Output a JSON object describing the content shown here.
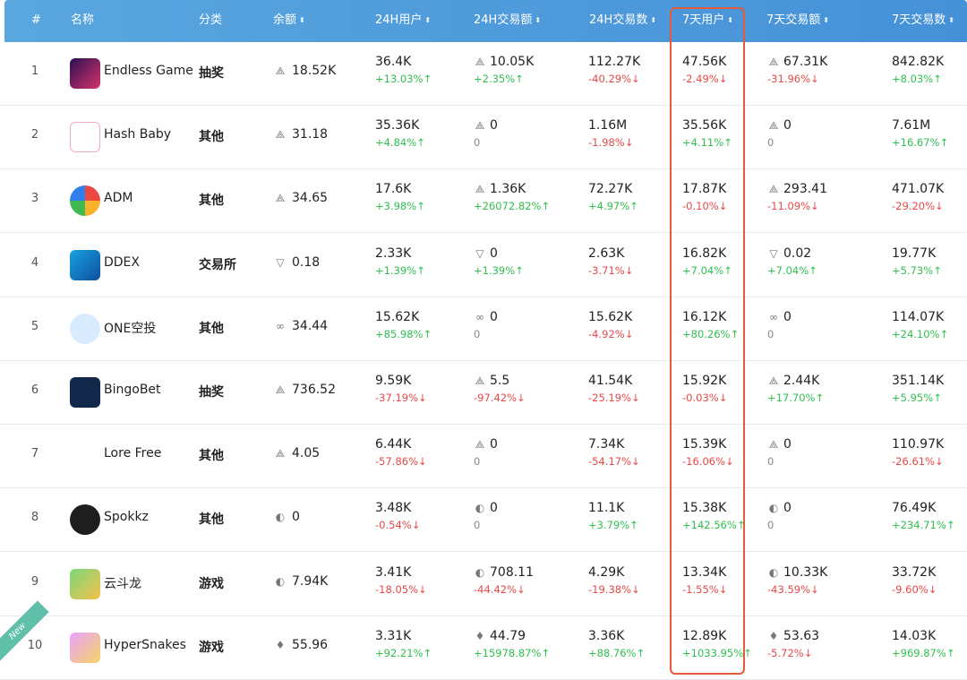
{
  "header": {
    "rank": "#",
    "name": "名称",
    "category": "分类",
    "balance": "余额",
    "users_24h": "24H用户",
    "volume_24h": "24H交易额",
    "tx_24h": "24H交易数",
    "users_7d": "7天用户",
    "volume_7d": "7天交易额",
    "tx_7d": "7天交易数",
    "sort_icon": "⬍"
  },
  "badge_new": "New",
  "accent_color": "#e55a3b",
  "rows": [
    {
      "rank": "1",
      "name": "Endless Game",
      "category": "抽奖",
      "token_icon": "eos-icon",
      "balance": "18.52K",
      "users_24h": "36.4K",
      "users_24h_change": "+13.03%",
      "vol_24h": "10.05K",
      "vol_24h_change": "+2.35%",
      "tx_24h": "112.27K",
      "tx_24h_change": "-40.29%",
      "users_7d": "47.56K",
      "users_7d_change": "-2.49%",
      "vol_7d": "67.31K",
      "vol_7d_change": "-31.96%",
      "tx_7d": "842.82K",
      "tx_7d_change": "+8.03%"
    },
    {
      "rank": "2",
      "name": "Hash Baby",
      "category": "其他",
      "token_icon": "eos-icon",
      "balance": "31.18",
      "users_24h": "35.36K",
      "users_24h_change": "+4.84%",
      "vol_24h": "0",
      "vol_24h_change": "0",
      "tx_24h": "1.16M",
      "tx_24h_change": "-1.98%",
      "users_7d": "35.56K",
      "users_7d_change": "+4.11%",
      "vol_7d": "0",
      "vol_7d_change": "0",
      "tx_7d": "7.61M",
      "tx_7d_change": "+16.67%"
    },
    {
      "rank": "3",
      "name": "ADM",
      "category": "其他",
      "token_icon": "eos-icon",
      "balance": "34.65",
      "users_24h": "17.6K",
      "users_24h_change": "+3.98%",
      "vol_24h": "1.36K",
      "vol_24h_change": "+26072.82%",
      "tx_24h": "72.27K",
      "tx_24h_change": "+4.97%",
      "users_7d": "17.87K",
      "users_7d_change": "-0.10%",
      "vol_7d": "293.41",
      "vol_7d_change": "-11.09%",
      "tx_7d": "471.07K",
      "tx_7d_change": "-29.20%"
    },
    {
      "rank": "4",
      "name": "DDEX",
      "category": "交易所",
      "token_icon": "tron-icon",
      "balance": "0.18",
      "users_24h": "2.33K",
      "users_24h_change": "+1.39%",
      "vol_24h": "0",
      "vol_24h_change": "+1.39%",
      "tx_24h": "2.63K",
      "tx_24h_change": "-3.71%",
      "users_7d": "16.82K",
      "users_7d_change": "+7.04%",
      "vol_7d": "0.02",
      "vol_7d_change": "+7.04%",
      "tx_7d": "19.77K",
      "tx_7d_change": "+5.73%"
    },
    {
      "rank": "5",
      "name": "ONE空投",
      "category": "其他",
      "token_icon": "ont-icon",
      "balance": "34.44",
      "users_24h": "15.62K",
      "users_24h_change": "+85.98%",
      "vol_24h": "0",
      "vol_24h_change": "0",
      "tx_24h": "15.62K",
      "tx_24h_change": "-4.92%",
      "users_7d": "16.12K",
      "users_7d_change": "+80.26%",
      "vol_7d": "0",
      "vol_7d_change": "0",
      "tx_7d": "114.07K",
      "tx_7d_change": "+24.10%"
    },
    {
      "rank": "6",
      "name": "BingoBet",
      "category": "抽奖",
      "token_icon": "eos-icon",
      "balance": "736.52",
      "users_24h": "9.59K",
      "users_24h_change": "-37.19%",
      "vol_24h": "5.5",
      "vol_24h_change": "-97.42%",
      "tx_24h": "41.54K",
      "tx_24h_change": "-25.19%",
      "users_7d": "15.92K",
      "users_7d_change": "-0.03%",
      "vol_7d": "2.44K",
      "vol_7d_change": "+17.70%",
      "tx_7d": "351.14K",
      "tx_7d_change": "+5.95%"
    },
    {
      "rank": "7",
      "name": "Lore Free",
      "category": "其他",
      "token_icon": "eos-icon",
      "balance": "4.05",
      "users_24h": "6.44K",
      "users_24h_change": "-57.86%",
      "vol_24h": "0",
      "vol_24h_change": "0",
      "tx_24h": "7.34K",
      "tx_24h_change": "-54.17%",
      "users_7d": "15.39K",
      "users_7d_change": "-16.06%",
      "vol_7d": "0",
      "vol_7d_change": "0",
      "tx_7d": "110.97K",
      "tx_7d_change": "-26.61%"
    },
    {
      "rank": "8",
      "name": "Spokkz",
      "category": "其他",
      "token_icon": "iost-icon",
      "balance": "0",
      "users_24h": "3.48K",
      "users_24h_change": "-0.54%",
      "vol_24h": "0",
      "vol_24h_change": "0",
      "tx_24h": "11.1K",
      "tx_24h_change": "+3.79%",
      "users_7d": "15.38K",
      "users_7d_change": "+142.56%",
      "vol_7d": "0",
      "vol_7d_change": "0",
      "tx_7d": "76.49K",
      "tx_7d_change": "+234.71%"
    },
    {
      "rank": "9",
      "name": "云斗龙",
      "category": "游戏",
      "token_icon": "iost-icon",
      "balance": "7.94K",
      "users_24h": "3.41K",
      "users_24h_change": "-18.05%",
      "vol_24h": "708.11",
      "vol_24h_change": "-44.42%",
      "tx_24h": "4.29K",
      "tx_24h_change": "-19.38%",
      "users_7d": "13.34K",
      "users_7d_change": "-1.55%",
      "vol_7d": "10.33K",
      "vol_7d_change": "-43.59%",
      "tx_7d": "33.72K",
      "tx_7d_change": "-9.60%"
    },
    {
      "rank": "10",
      "name": "HyperSnakes",
      "category": "游戏",
      "token_icon": "eth-icon",
      "balance": "55.96",
      "users_24h": "3.31K",
      "users_24h_change": "+92.21%",
      "vol_24h": "44.79",
      "vol_24h_change": "+15978.87%",
      "tx_24h": "3.36K",
      "tx_24h_change": "+88.76%",
      "users_7d": "12.89K",
      "users_7d_change": "+1033.95%",
      "vol_7d": "53.63",
      "vol_7d_change": "-5.72%",
      "tx_7d": "14.03K",
      "tx_7d_change": "+969.87%"
    }
  ]
}
